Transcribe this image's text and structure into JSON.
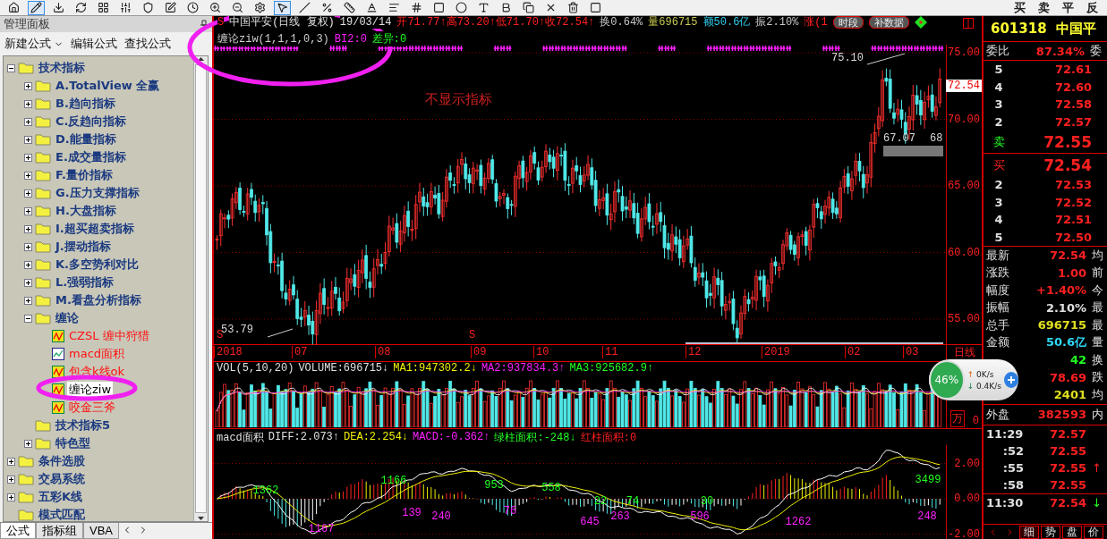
{
  "toolbar": {
    "trade_buttons": [
      "买",
      "卖",
      "平",
      "反"
    ]
  },
  "panel": {
    "title": "管理面板",
    "actions": [
      {
        "label": "新建公式",
        "dropdown": true
      },
      {
        "label": "编辑公式",
        "dropdown": false
      },
      {
        "label": "查找公式",
        "dropdown": false
      }
    ],
    "tree": [
      {
        "label": "技术指标",
        "kind": "folder",
        "expanded": true,
        "selected": false,
        "children": [
          {
            "label": "A.TotalView 全赢",
            "kind": "folder",
            "expanded": false,
            "selected": false
          },
          {
            "label": "B.趋向指标",
            "kind": "folder",
            "expanded": false,
            "selected": false
          },
          {
            "label": "C.反趋向指标",
            "kind": "folder",
            "expanded": false,
            "selected": false
          },
          {
            "label": "D.能量指标",
            "kind": "folder",
            "expanded": false,
            "selected": false
          },
          {
            "label": "E.成交量指标",
            "kind": "folder",
            "expanded": false,
            "selected": false
          },
          {
            "label": "F.量价指标",
            "kind": "folder",
            "expanded": false,
            "selected": false
          },
          {
            "label": "G.压力支撑指标",
            "kind": "folder",
            "expanded": false,
            "selected": false
          },
          {
            "label": "H.大盘指标",
            "kind": "folder",
            "expanded": false,
            "selected": false
          },
          {
            "label": "I.超买超卖指标",
            "kind": "folder",
            "expanded": false,
            "selected": false
          },
          {
            "label": "J.摆动指标",
            "kind": "folder",
            "expanded": false,
            "selected": false
          },
          {
            "label": "K.多空势利对比",
            "kind": "folder",
            "expanded": false,
            "selected": false
          },
          {
            "label": "L.强弱指标",
            "kind": "folder",
            "expanded": false,
            "selected": false
          },
          {
            "label": "M.看盘分析指标",
            "kind": "folder",
            "expanded": false,
            "selected": false
          },
          {
            "label": "缠论",
            "kind": "folder",
            "expanded": true,
            "selected": false,
            "children": [
              {
                "label": "CZSL 缠中狩猎",
                "kind": "formula",
                "selected": false
              },
              {
                "label": "macd面积",
                "kind": "line_formula",
                "selected": false
              },
              {
                "label": "包含k线ok",
                "kind": "formula",
                "selected": false
              },
              {
                "label": "缠论ziw",
                "kind": "formula",
                "selected": true
              },
              {
                "label": "咬金三斧",
                "kind": "formula",
                "selected": false
              }
            ]
          },
          {
            "label": "技术指标5",
            "kind": "folder",
            "selected": false
          },
          {
            "label": "特色型",
            "kind": "folder",
            "expanded": false,
            "selected": false
          }
        ]
      },
      {
        "label": "条件选股",
        "kind": "folder",
        "expanded": false,
        "selected": false
      },
      {
        "label": "交易系统",
        "kind": "folder",
        "expanded": false,
        "selected": false
      },
      {
        "label": "五彩K线",
        "kind": "folder",
        "expanded": false,
        "selected": false
      },
      {
        "label": "模式匹配",
        "kind": "folder",
        "selected": false
      }
    ],
    "bottom_tabs": [
      {
        "label": "公式",
        "selected": true
      },
      {
        "label": "指标组",
        "selected": false
      },
      {
        "label": "VBA",
        "selected": false
      }
    ]
  },
  "chart": {
    "marker": "S",
    "title": "中国平安(日线 复权)",
    "date": "19/03/14",
    "quote": [
      {
        "text": "开71.77↑",
        "color": "#ff2020"
      },
      {
        "text": "高73.20↑",
        "color": "#ff2020"
      },
      {
        "text": "低71.70↑",
        "color": "#ff2020"
      },
      {
        "text": "收72.54↑",
        "color": "#ff2020"
      },
      {
        "text": "换0.64%",
        "color": "#c8c8c8"
      },
      {
        "text": "量696715",
        "color": "#c8c850"
      },
      {
        "text": "额50.6亿",
        "color": "#30d0f0"
      },
      {
        "text": "振2.10%",
        "color": "#c8c8c8"
      },
      {
        "text": "涨(1",
        "color": "#ff2020"
      }
    ],
    "buttons": [
      "时段",
      "补数据"
    ],
    "indicator": [
      {
        "text": "缠论ziw(1,1,1,0,3)",
        "color": "#d0d0d0"
      },
      {
        "text": "BI2:0",
        "color": "#ff20ff"
      },
      {
        "text": "差异:0",
        "color": "#20ff20"
      }
    ],
    "note": "不显示指标",
    "price_labels": [
      "75.00",
      "70.00",
      "65.00",
      "60.00",
      "55.00"
    ],
    "current_price": "72.54",
    "annotations": [
      "75.10",
      "53.79",
      "67.07",
      "68"
    ],
    "signal_markers": [
      "S",
      "S"
    ],
    "dates": [
      "2018",
      "07",
      "08",
      "09",
      "10",
      "11",
      "12",
      "2019",
      "02",
      "03"
    ],
    "period": "日线",
    "volume": {
      "header": [
        {
          "text": "VOL(5,10,20)",
          "color": "#e0e0e0"
        },
        {
          "text": "VOLUME:696715↓",
          "color": "#e0e0e0"
        },
        {
          "text": "MA1:947302.2↓",
          "color": "#f0f000"
        },
        {
          "text": "MA2:937834.3↑",
          "color": "#ff20ff"
        },
        {
          "text": "MA3:925682.9↑",
          "color": "#20ff20"
        }
      ],
      "unit": "万",
      "zero": "0"
    },
    "macd": {
      "header": [
        {
          "text": "macd面积",
          "color": "#e0e0e0"
        },
        {
          "text": "DIFF:2.073↑",
          "color": "#e0e0e0"
        },
        {
          "text": "DEA:2.254↓",
          "color": "#f0f000"
        },
        {
          "text": "MACD:-0.362↑",
          "color": "#ff20ff"
        },
        {
          "text": "绿柱面积:-248↓",
          "color": "#20ff20"
        },
        {
          "text": "红柱面积:0",
          "color": "#ff2020"
        }
      ],
      "labels": [
        {
          "text": "1362",
          "color": "#20ff20"
        },
        {
          "text": "1167",
          "color": "#ff20ff"
        },
        {
          "text": "1166",
          "color": "#20ff20"
        },
        {
          "text": "139",
          "color": "#ff20ff"
        },
        {
          "text": "240",
          "color": "#ff20ff"
        },
        {
          "text": "953",
          "color": "#20ff20"
        },
        {
          "text": "76",
          "color": "#ff20ff"
        },
        {
          "text": "558",
          "color": "#20ff20"
        },
        {
          "text": "645",
          "color": "#ff20ff"
        },
        {
          "text": "22",
          "color": "#20ff20"
        },
        {
          "text": "263",
          "color": "#ff20ff"
        },
        {
          "text": "74",
          "color": "#20ff20"
        },
        {
          "text": "596",
          "color": "#ff20ff"
        },
        {
          "text": "30",
          "color": "#20ff20"
        },
        {
          "text": "1262",
          "color": "#ff20ff"
        },
        {
          "text": "3499",
          "color": "#20ff20"
        },
        {
          "text": "248",
          "color": "#ff20ff"
        }
      ],
      "axis": [
        "2.00",
        "0.00",
        "-2.00"
      ]
    }
  },
  "speed_widget": {
    "percent": "46%",
    "up": "0K/s",
    "down": "0.4K/s"
  },
  "quote": {
    "code": "601318",
    "name": "中国平",
    "ratio_label": "委比",
    "ratio": "87.34%",
    "ratio_label_2": "委",
    "asks": [
      {
        "label": "5",
        "price": "72.61"
      },
      {
        "label": "4",
        "price": "72.60"
      },
      {
        "label": "3",
        "price": "72.58"
      },
      {
        "label": "2",
        "price": "72.57"
      },
      {
        "label": "卖",
        "price": "72.55"
      }
    ],
    "bids": [
      {
        "label": "买",
        "price": "72.54"
      },
      {
        "label": "2",
        "price": "72.53"
      },
      {
        "label": "3",
        "price": "72.52"
      },
      {
        "label": "4",
        "price": "72.51"
      },
      {
        "label": "5",
        "price": "72.50"
      }
    ],
    "stats": [
      {
        "label": "最新",
        "value": "72.54",
        "color": "#ff2020",
        "right": "均"
      },
      {
        "label": "涨跌",
        "value": "1.00",
        "color": "#ff2020",
        "right": "前"
      },
      {
        "label": "幅度",
        "value": "+1.40%",
        "color": "#ff2020",
        "right": "今"
      },
      {
        "label": "振幅",
        "value": "2.10%",
        "color": "#e0e0e0",
        "right": "最"
      },
      {
        "label": "总手",
        "value": "696715",
        "color": "#e0e020",
        "right": "最"
      },
      {
        "label": "金额",
        "value": "50.6亿",
        "color": "#30d8f8",
        "right": "量"
      },
      {
        "value": "42",
        "color": "#20ff20",
        "right": "换"
      },
      {
        "value": "78.69",
        "color": "#ff2020",
        "right": "跌"
      },
      {
        "value": "2401",
        "color": "#e0e020",
        "right": "均"
      }
    ],
    "outer_label": "外盘",
    "outer": "382593",
    "inner_label": "内",
    "ticks": [
      {
        "time": "11:29",
        "price": "72.57"
      },
      {
        "time": ":52",
        "price": "72.55"
      },
      {
        "time": ":55",
        "price": "72.55",
        "arrow": "↑"
      },
      {
        "time": ":58",
        "price": "72.55"
      },
      {
        "time": "11:30",
        "price": "72.54",
        "arrow": "↓"
      }
    ],
    "tabs": [
      {
        "label": "细",
        "selected": true
      },
      {
        "label": "势",
        "selected": false
      },
      {
        "label": "盘",
        "selected": false
      },
      {
        "label": "价",
        "selected": false
      }
    ]
  }
}
